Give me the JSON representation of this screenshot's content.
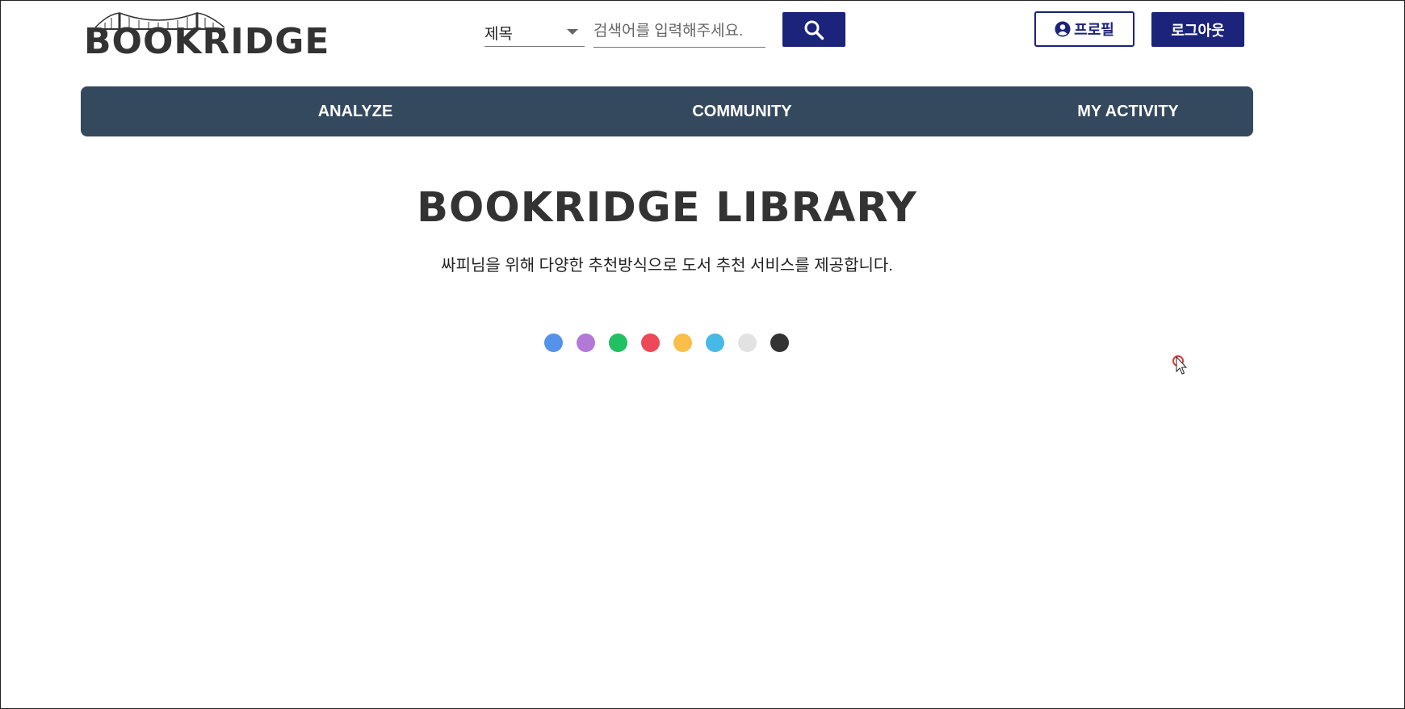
{
  "header": {
    "logo_text": "BOOKRIDGE",
    "search": {
      "category": "제목",
      "placeholder": "검색어를 입력해주세요.",
      "button_icon": "search-icon"
    },
    "profile_label": "프로필",
    "profile_icon": "user-circle-icon",
    "logout_label": "로그아웃"
  },
  "nav": {
    "items": [
      {
        "label": "ANALYZE"
      },
      {
        "label": "COMMUNITY"
      },
      {
        "label": "MY ACTIVITY"
      }
    ]
  },
  "main": {
    "title": "BOOKRIDGE LIBRARY",
    "subtitle": "싸피님을 위해 다양한 추천방식으로 도서 추천 서비스를 제공합니다.",
    "loading_dots": [
      "#5592ea",
      "#b27ad6",
      "#21c063",
      "#ed4959",
      "#fbbe48",
      "#47b9e6",
      "#e2e2e2",
      "#333333"
    ]
  },
  "colors": {
    "primary": "#1b237b",
    "nav_bg": "#34495e",
    "text": "#333333"
  }
}
